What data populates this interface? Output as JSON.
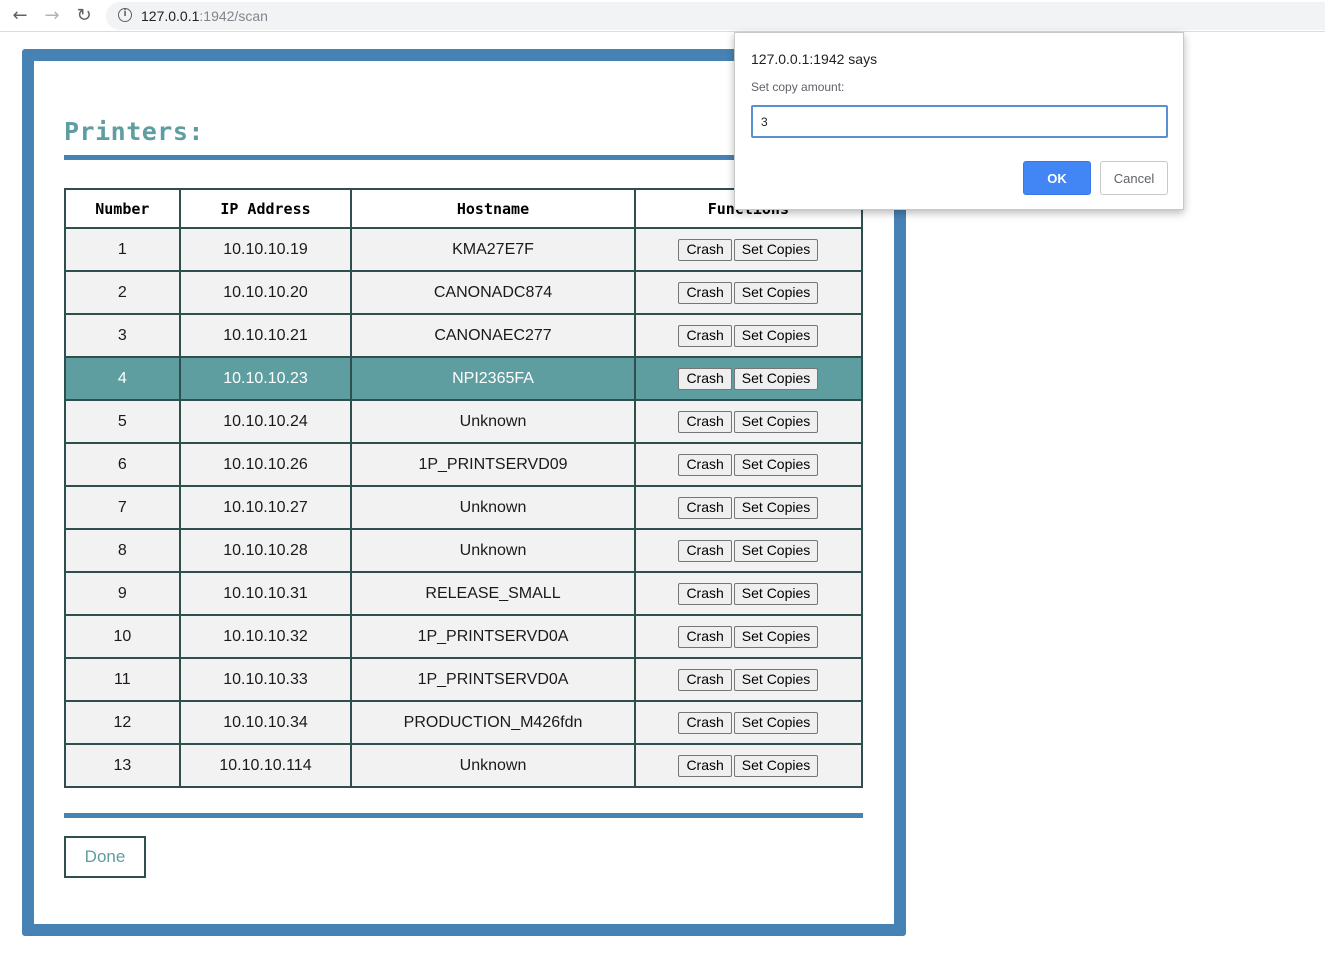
{
  "browser": {
    "url_host": "127.0.0.1",
    "url_path": ":1942/scan"
  },
  "page": {
    "title": "Printers:",
    "done_label": "Done"
  },
  "table": {
    "headers": [
      "Number",
      "IP Address",
      "Hostname",
      "Functions"
    ],
    "crash_label": "Crash",
    "set_copies_label": "Set Copies",
    "selected_row": 4,
    "rows": [
      {
        "number": "1",
        "ip": "10.10.10.19",
        "hostname": "KMA27E7F"
      },
      {
        "number": "2",
        "ip": "10.10.10.20",
        "hostname": "CANONADC874"
      },
      {
        "number": "3",
        "ip": "10.10.10.21",
        "hostname": "CANONAEC277"
      },
      {
        "number": "4",
        "ip": "10.10.10.23",
        "hostname": "NPI2365FA"
      },
      {
        "number": "5",
        "ip": "10.10.10.24",
        "hostname": "Unknown"
      },
      {
        "number": "6",
        "ip": "10.10.10.26",
        "hostname": "1P_PRINTSERVD09"
      },
      {
        "number": "7",
        "ip": "10.10.10.27",
        "hostname": "Unknown"
      },
      {
        "number": "8",
        "ip": "10.10.10.28",
        "hostname": "Unknown"
      },
      {
        "number": "9",
        "ip": "10.10.10.31",
        "hostname": "RELEASE_SMALL"
      },
      {
        "number": "10",
        "ip": "10.10.10.32",
        "hostname": "1P_PRINTSERVD0A"
      },
      {
        "number": "11",
        "ip": "10.10.10.33",
        "hostname": "1P_PRINTSERVD0A"
      },
      {
        "number": "12",
        "ip": "10.10.10.34",
        "hostname": "PRODUCTION_M426fdn"
      },
      {
        "number": "13",
        "ip": "10.10.10.114",
        "hostname": "Unknown"
      }
    ]
  },
  "dialog": {
    "title": "127.0.0.1:1942 says",
    "message": "Set copy amount:",
    "input_value": "3",
    "ok_label": "OK",
    "cancel_label": "Cancel"
  },
  "colors": {
    "frame": "#4682b4",
    "accent": "#5f9ea0",
    "table_border": "#2f4f4f",
    "ok_button": "#4285f4"
  },
  "icons": [
    "back-arrow-icon",
    "forward-arrow-icon",
    "reload-icon",
    "info-icon"
  ]
}
